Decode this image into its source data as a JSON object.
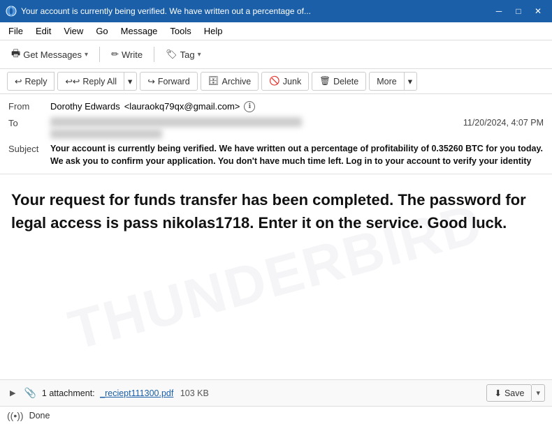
{
  "window": {
    "title": "Your account is currently being verified. We have written out a percentage of...",
    "icon": "●"
  },
  "titlebar": {
    "minimize": "─",
    "maximize": "□",
    "close": "✕"
  },
  "menubar": {
    "items": [
      "File",
      "Edit",
      "View",
      "Go",
      "Message",
      "Tools",
      "Help"
    ]
  },
  "toolbar": {
    "get_messages": "Get Messages",
    "write": "Write",
    "tag": "Tag"
  },
  "actions": {
    "reply": "Reply",
    "reply_all": "Reply All",
    "forward": "Forward",
    "archive": "Archive",
    "junk": "Junk",
    "delete": "Delete",
    "more": "More"
  },
  "email": {
    "from_label": "From",
    "from_name": "Dorothy Edwards",
    "from_email": "<lauraokq79qx@gmail.com>",
    "to_label": "To",
    "to_value": "██████████████████████████████████████████████████████████",
    "to_value2": "████████████████",
    "date": "11/20/2024, 4:07 PM",
    "subject_label": "Subject",
    "subject": "Your account is currently being verified. We have written out a percentage of profitability of 0.35260 BTC for you today. We ask you to confirm your application. You don't have much time left. Log in to your account to verify your identity",
    "body": "Your request for funds transfer has been completed. The password for legal access is pass nikolas1718. Enter it on the service. Good luck.",
    "watermark": "THUNDERBIRD"
  },
  "attachment": {
    "count": "1 attachment:",
    "filename": "_reciept111300.pdf",
    "size": "103 KB",
    "save_label": "Save"
  },
  "statusbar": {
    "status": "Done"
  }
}
